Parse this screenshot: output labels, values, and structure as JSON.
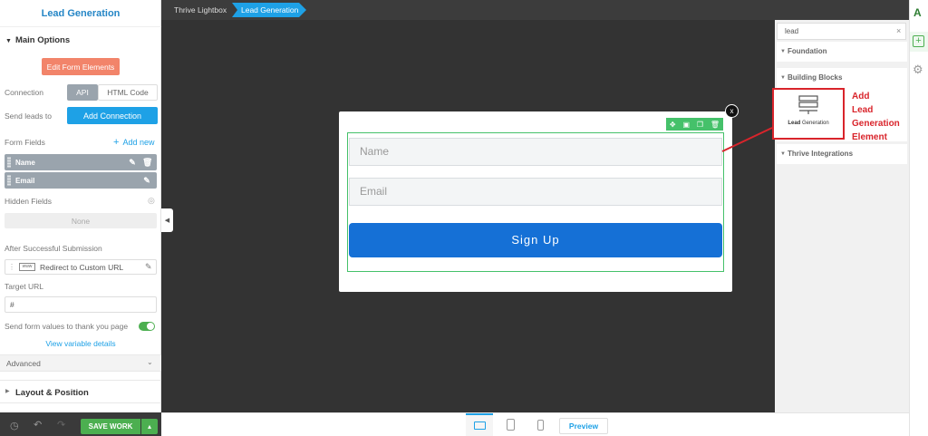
{
  "left_panel": {
    "title": "Lead Generation",
    "main_options": "Main Options",
    "edit_form_elements": "Edit Form Elements",
    "connection_label": "Connection",
    "connection_api": "API",
    "connection_html": "HTML Code",
    "send_leads_label": "Send leads to",
    "add_connection": "Add Connection",
    "form_fields_label": "Form Fields",
    "add_new": "Add new",
    "fields": [
      "Name",
      "Email"
    ],
    "hidden_fields_label": "Hidden Fields",
    "hidden_none": "None",
    "after_submission_label": "After Successful Submission",
    "redirect_option": "Redirect to Custom URL",
    "target_url_label": "Target URL",
    "target_url_value": "#",
    "send_values_label": "Send form values to thank you page",
    "view_variable_details": "View variable details",
    "advanced": "Advanced",
    "layout_position": "Layout & Position"
  },
  "breadcrumbs": [
    "Thrive Lightbox",
    "Lead Generation"
  ],
  "form": {
    "name_placeholder": "Name",
    "email_placeholder": "Email",
    "submit_label": "Sign Up",
    "close_glyph": "x"
  },
  "bottom_bar": {
    "save_label": "SAVE WORK",
    "preview_label": "Preview"
  },
  "right_panel": {
    "search_value": "lead",
    "search_clear": "×",
    "categories": [
      "Foundation",
      "Building Blocks",
      "Thrive Integrations"
    ],
    "element_bold": "Lead",
    "element_rest": " Generation"
  },
  "annotation": [
    "Add",
    "Lead",
    "Generation",
    "Element"
  ],
  "colors": {
    "accent_blue": "#1570d6",
    "title_blue": "#2586c6",
    "green": "#4caf50",
    "edit_button": "#f2846a",
    "annotation_red": "#d9242b"
  }
}
